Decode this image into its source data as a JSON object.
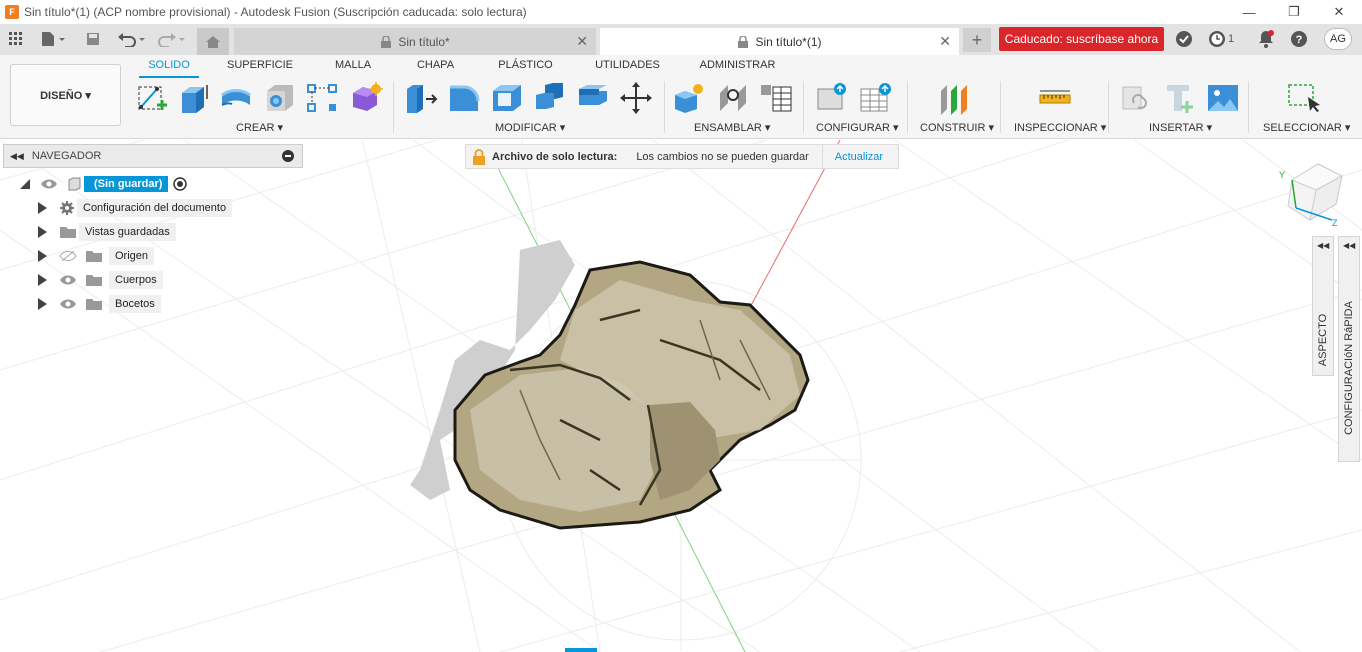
{
  "window": {
    "title": "Sin título*(1) (ACP nombre provisional) - Autodesk Fusion (Suscripción caducada: solo lectura)",
    "logo": "F"
  },
  "tabs": [
    {
      "label": "Sin título*"
    },
    {
      "label": "Sin título*(1)"
    }
  ],
  "header": {
    "expired_label": "Caducado: suscríbase ahora",
    "jobs_count": "1",
    "avatar": "AG"
  },
  "workspace": {
    "label": "DISEÑO ▾"
  },
  "ribbon_tabs": [
    "SOLIDO",
    "SUPERFICIE",
    "MALLA",
    "CHAPA",
    "PLÁSTICO",
    "UTILIDADES",
    "ADMINISTRAR"
  ],
  "groups": [
    "CREAR ▾",
    "MODIFICAR ▾",
    "ENSAMBLAR ▾",
    "CONFIGURAR ▾",
    "CONSTRUIR ▾",
    "INSPECCIONAR ▾",
    "INSERTAR ▾",
    "SELECCIONAR ▾"
  ],
  "navigator": {
    "title": "NAVEGADOR",
    "root": "(Sin guardar)",
    "items": [
      "Configuración del documento",
      "Vistas guardadas",
      "Origen",
      "Cuerpos",
      "Bocetos"
    ]
  },
  "readonly": {
    "title": "Archivo de solo lectura:",
    "message": "Los cambios no se pueden guardar",
    "action": "Actualizar"
  },
  "side_panels": {
    "aspect": "ASPECTO",
    "quick": "CONFIGURACIóN RáPIDA"
  },
  "colors": {
    "accent": "#0696d7",
    "expired": "#d8262a",
    "rock": "#b9ab86"
  }
}
